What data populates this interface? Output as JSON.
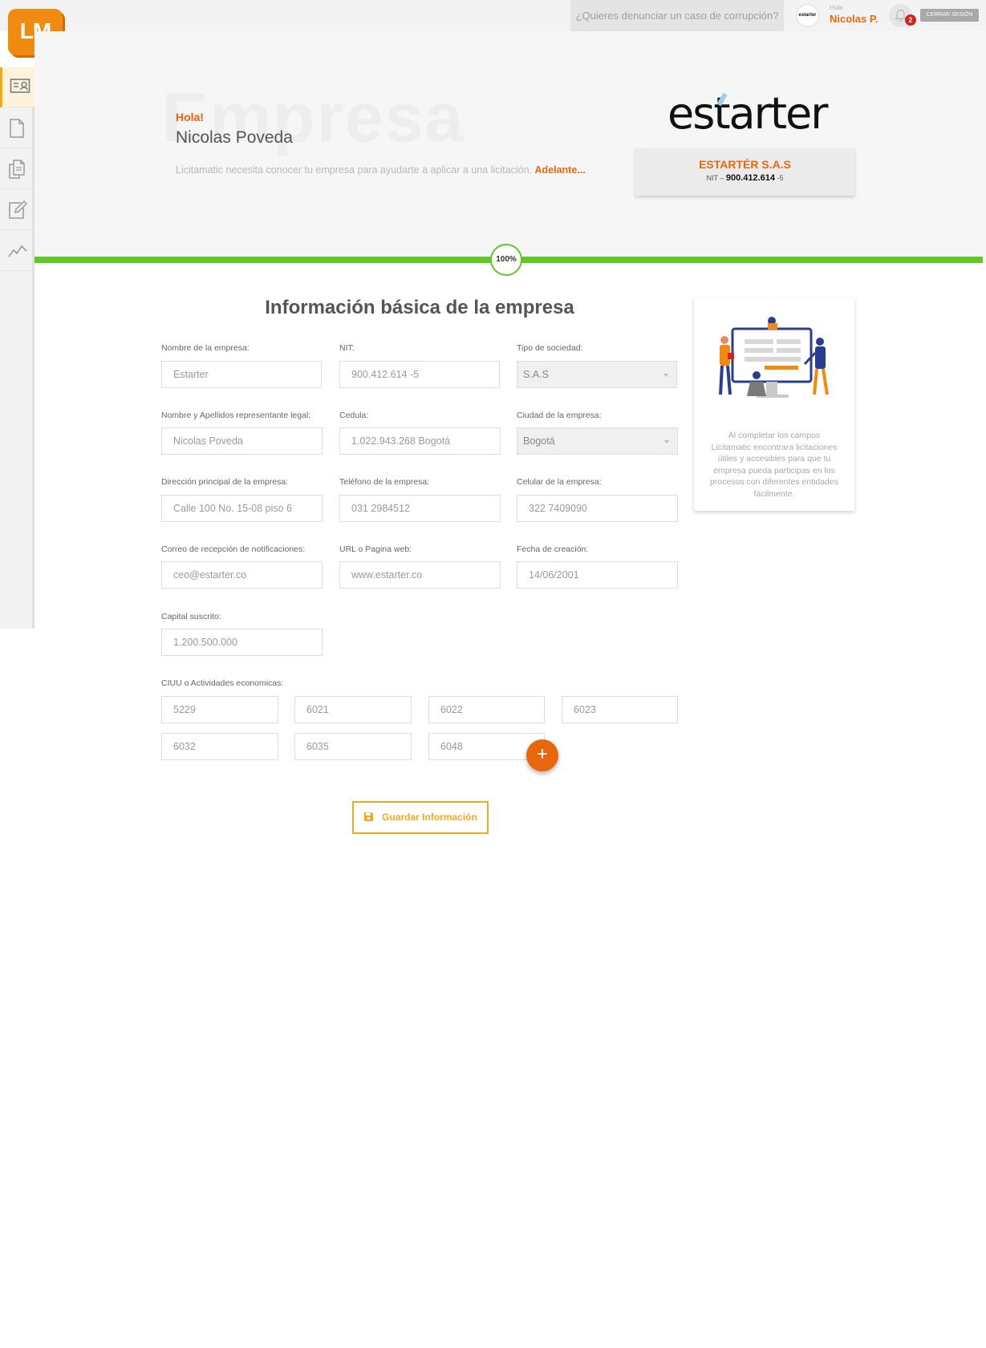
{
  "header": {
    "corruption_link": "¿Quieres denunciar un caso de corrupción?",
    "avatar_text": "estarter",
    "greeting_small": "Hola",
    "user_short": "Nicolas P.",
    "notification_count": "2",
    "logout_label": "CERRAR SESIÓN"
  },
  "logo": {
    "text": "LM"
  },
  "sidebar": {
    "items": [
      {
        "icon": "id-card-icon",
        "active": true
      },
      {
        "icon": "document-icon",
        "active": false
      },
      {
        "icon": "documents-icon",
        "active": false
      },
      {
        "icon": "edit-icon",
        "active": false
      },
      {
        "icon": "trend-chart-icon",
        "active": false
      }
    ]
  },
  "hero": {
    "background_word": "Empresa",
    "hola": "Hola!",
    "name": "Nicolas Poveda",
    "description": "Licitamatic necesita conocer tu empresa para ayudarte a aplicar a una licitación.",
    "description_link": "Adelante...",
    "brand_logo": "estarter",
    "company_name": "ESTARTÉR S.A.S",
    "nit_prefix": "NIT –",
    "nit_number": "900.412.614",
    "nit_suffix": "-5"
  },
  "progress": {
    "label": "100%",
    "value": 1.0
  },
  "form": {
    "title": "Información básica de la empresa",
    "fields": {
      "company_name": {
        "label": "Nombre de la empresa:",
        "value": "Estarter"
      },
      "nit": {
        "label": "NIT:",
        "value": "900.412.614 -5"
      },
      "society_type": {
        "label": "Tipo de sociedad:",
        "value": "S.A.S"
      },
      "legal_rep": {
        "label": "Nombre y Apellidos representante legal:",
        "value": "Nicolas Poveda"
      },
      "id_number": {
        "label": "Cedula:",
        "value": "1.022.943.268 Bogotá"
      },
      "city": {
        "label": "Ciudad de la empresa:",
        "value": "Bogotá"
      },
      "address": {
        "label": "Dirección principal de la empresa:",
        "value": "Calle 100 No. 15-08 piso 6"
      },
      "phone": {
        "label": "Teléfono de la empresa:",
        "value": "031 2984512"
      },
      "mobile": {
        "label": "Celular de la empresa:",
        "value": "322 7409090"
      },
      "email": {
        "label": "Correo de recepción de notificaciones:",
        "value": "ceo@estarter.co"
      },
      "website": {
        "label": "URL o Pagina web:",
        "value": "www.estarter.co"
      },
      "founded": {
        "label": "Fecha de creación:",
        "value": "14/06/2001"
      },
      "capital": {
        "label": "Capital suscrito:",
        "value": "1.200.500.000"
      }
    },
    "ciiu": {
      "label": "CIUU o Actividades economicas:",
      "codes": [
        "5229",
        "6021",
        "6022",
        "6023",
        "6032",
        "6035",
        "6048"
      ]
    },
    "add_symbol": "+",
    "save_label": "Guardar Información"
  },
  "info_card": {
    "text": "Al completar los campos Licitamatic encontrara licitaciones útiles y accesibles para que tu empresa pueda participas en los procesos con diferentes entidades fácilmente."
  },
  "colors": {
    "accent_orange": "#e8670c",
    "save_orange": "#f5a623",
    "progress_green": "#62c726"
  }
}
